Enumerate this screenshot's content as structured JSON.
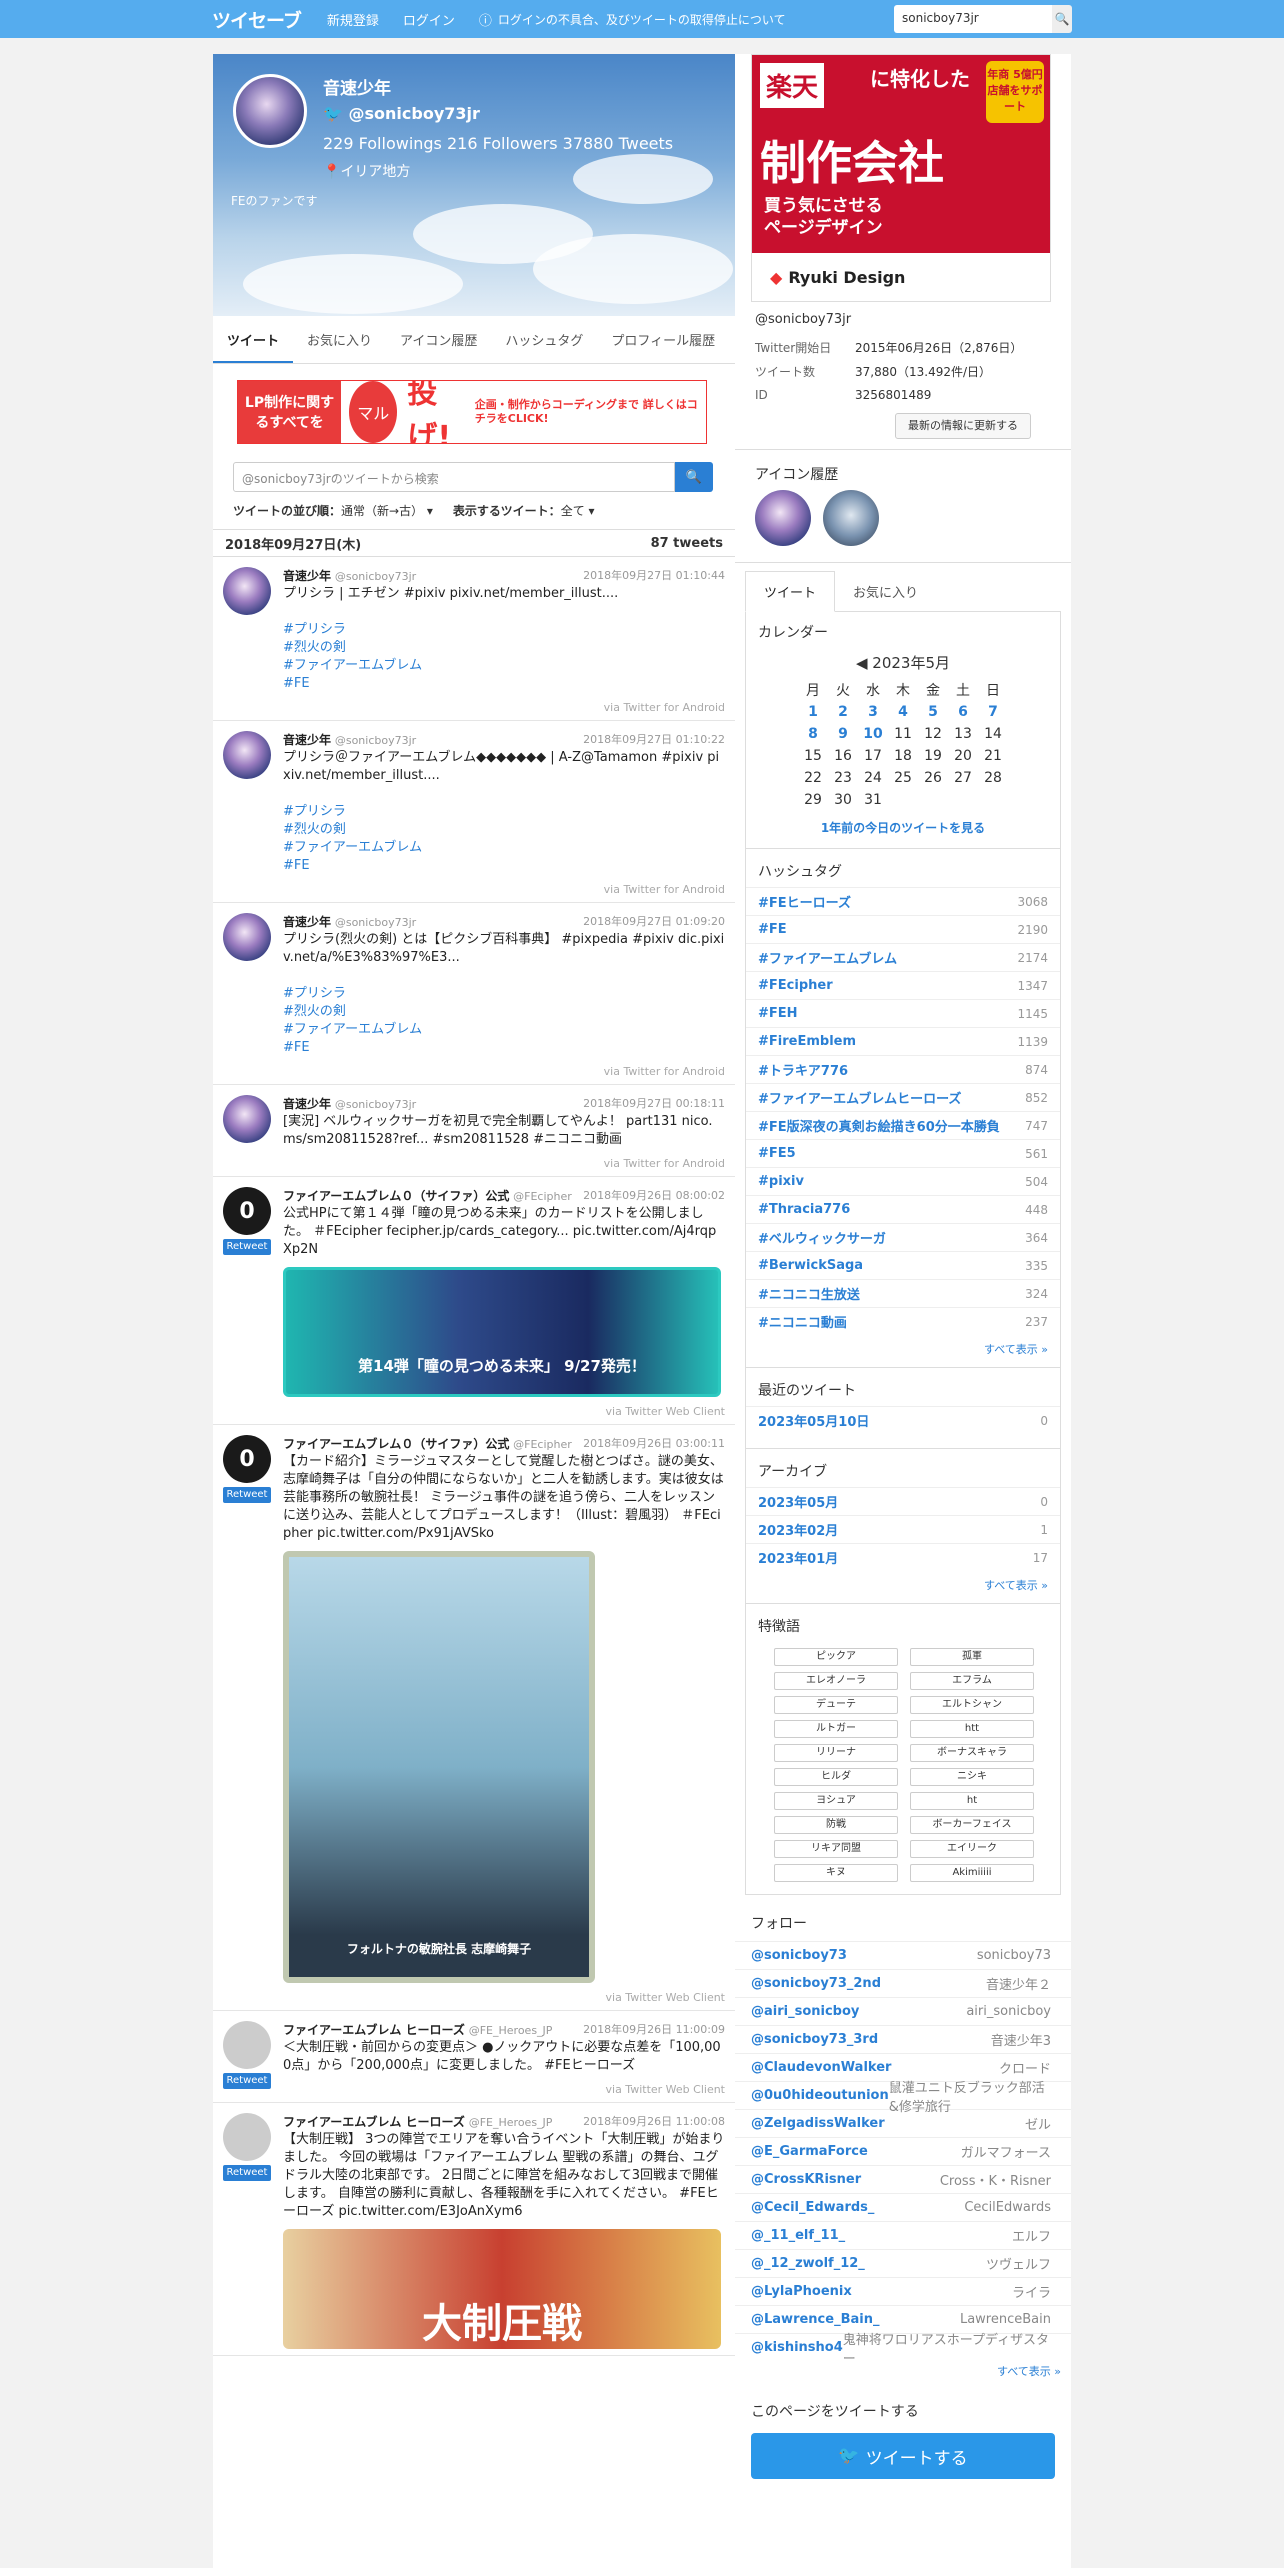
{
  "nav": {
    "logo": "ツイセーブ",
    "register": "新規登録",
    "login": "ログイン",
    "notice": "ログインの不具合、及びツイートの取得停止について",
    "search_value": "sonicboy73jr"
  },
  "profile": {
    "name": "音速少年",
    "handle": "@sonicboy73jr",
    "stats": "229 Followings  216 Followers  37880 Tweets",
    "location": "イリア地方",
    "bio": "FEのファンです"
  },
  "tabs": [
    "ツイート",
    "お気に入り",
    "アイコン履歴",
    "ハッシュタグ",
    "プロフィール履歴"
  ],
  "banner": {
    "t1": "LP制作に関するすべてを",
    "t2": "マル",
    "t3": "投げ!",
    "t4": "企画・制作からコーディングまで 詳しくはコチラをCLICK!"
  },
  "search": {
    "placeholder": "@sonicboy73jrのツイートから検索"
  },
  "sort": {
    "order_label": "ツイートの並び順：",
    "order_value": "通常（新→古）",
    "type_label": "表示するツイート：",
    "type_value": "全て"
  },
  "datebar": {
    "date": "2018年09月27日(木)",
    "count": "87 tweets"
  },
  "tweets": [
    {
      "name": "音速少年",
      "handle": "@sonicboy73jr",
      "time": "2018年09月27日 01:10:44",
      "body": "プリシラ | エチゼン #pixiv pixiv.net/member_illust....",
      "tags": [
        "#プリシラ",
        "#烈火の剣",
        "#ファイアーエムブレム",
        "#FE"
      ],
      "via": "via Twitter for Android"
    },
    {
      "name": "音速少年",
      "handle": "@sonicboy73jr",
      "time": "2018年09月27日 01:10:22",
      "body": "プリシラ＠ファイアーエムブレム◆◆◆◆◆◆◆ | A-Z@Tamamon #pixiv pixiv.net/member_illust....",
      "tags": [
        "#プリシラ",
        "#烈火の剣",
        "#ファイアーエムブレム",
        "#FE"
      ],
      "via": "via Twitter for Android"
    },
    {
      "name": "音速少年",
      "handle": "@sonicboy73jr",
      "time": "2018年09月27日 01:09:20",
      "body": "プリシラ(烈火の剣) とは【ピクシブ百科事典】 #pixpedia #pixiv dic.pixiv.net/a/%E3%83%97%E3...",
      "tags": [
        "#プリシラ",
        "#烈火の剣",
        "#ファイアーエムブレム",
        "#FE"
      ],
      "via": "via Twitter for Android"
    },
    {
      "name": "音速少年",
      "handle": "@sonicboy73jr",
      "time": "2018年09月27日 00:18:11",
      "body": "[実況] ベルウィックサーガを初見で完全制覇してやんよ！ part131 nico.ms/sm20811528?ref... #sm20811528 #ニコニコ動画",
      "tags": [],
      "via": "via Twitter for Android"
    },
    {
      "name": "ファイアーエムブレム０（サイファ）公式",
      "handle": "@FEcipher",
      "time": "2018年09月26日 08:00:02",
      "body": "公式HPにて第１４弾「瞳の見つめる未来」のカードリストを公開しました。 ＃FEcipher fecipher.jp/cards_category... pic.twitter.com/Aj4rqpXp2N",
      "tags": [],
      "via": "via Twitter Web Client",
      "rt": "Retweet",
      "media": "第14弾「瞳の見つめる未来」 9/27発売！"
    },
    {
      "name": "ファイアーエムブレム０（サイファ）公式",
      "handle": "@FEcipher",
      "time": "2018年09月26日 03:00:11",
      "body": "【カード紹介】ミラージュマスターとして覚醒した樹とつばさ。謎の美女、志摩崎舞子は「自分の仲間にならないか」と二人を勧誘します。実は彼女は芸能事務所の敏腕社長！ ミラージュ事件の謎を追う傍ら、二人をレッスンに送り込み、芸能人としてプロデュースします！（Illust：碧風羽） ＃FEcipher pic.twitter.com/Px91jAVSko",
      "tags": [],
      "via": "via Twitter Web Client",
      "rt": "Retweet",
      "media": "フォルトナの敏腕社長 志摩崎舞子"
    },
    {
      "name": "ファイアーエムブレム ヒーローズ",
      "handle": "@FE_Heroes_JP",
      "time": "2018年09月26日 11:00:09",
      "body": "＜大制圧戦・前回からの変更点＞ ●ノックアウトに必要な点差を「100,000点」から「200,000点」に変更しました。 #FEヒーローズ",
      "tags": [],
      "via": "via Twitter Web Client",
      "rt": "Retweet"
    },
    {
      "name": "ファイアーエムブレム ヒーローズ",
      "handle": "@FE_Heroes_JP",
      "time": "2018年09月26日 11:00:08",
      "body": "【大制圧戦】 3つの陣営でエリアを奪い合うイベント「大制圧戦」が始まりました。 今回の戦場は「ファイアーエムブレム 聖戦の系譜」の舞台、ユグドラル大陸の北東部です。 2日間ごとに陣営を組みなおして3回戦まで開催します。 自陣営の勝利に貢献し、各種報酬を手に入れてください。 #FEヒーローズ pic.twitter.com/E3JoAnXym6",
      "tags": [],
      "via": "",
      "rt": "Retweet",
      "media": "大制圧戦"
    }
  ],
  "ad": {
    "raku": "楽天",
    "t1": "に特化した",
    "badge": "年商 5億円 店舗をサポート",
    "t2": "制作会社",
    "t3": "買う気にさせる ページデザイン",
    "bottom": "Ryuki Design"
  },
  "info": {
    "handle": "@sonicboy73jr",
    "rows": [
      {
        "k": "Twitter開始日",
        "v": "2015年06月26日（2,876日）"
      },
      {
        "k": "ツイート数",
        "v": "37,880（13.492件/日）"
      },
      {
        "k": "ID",
        "v": "3256801489"
      }
    ],
    "update": "最新の情報に更新する"
  },
  "icon_history_title": "アイコン履歴",
  "stabs": [
    "ツイート",
    "お気に入り"
  ],
  "calendar": {
    "title": "カレンダー",
    "month": "◀ 2023年5月",
    "week": [
      "月",
      "火",
      "水",
      "木",
      "金",
      "土",
      "日"
    ],
    "rows": [
      [
        "1",
        "2",
        "3",
        "4",
        "5",
        "6",
        "7"
      ],
      [
        "8",
        "9",
        "10",
        "11",
        "12",
        "13",
        "14"
      ],
      [
        "15",
        "16",
        "17",
        "18",
        "19",
        "20",
        "21"
      ],
      [
        "22",
        "23",
        "24",
        "25",
        "26",
        "27",
        "28"
      ],
      [
        "29",
        "30",
        "31",
        "",
        "",
        "",
        ""
      ]
    ],
    "link": "1年前の今日のツイートを見る"
  },
  "hashtags": {
    "title": "ハッシュタグ",
    "items": [
      [
        "#FEヒーローズ",
        "3068"
      ],
      [
        "#FE",
        "2190"
      ],
      [
        "#ファイアーエムブレム",
        "2174"
      ],
      [
        "#FEcipher",
        "1347"
      ],
      [
        "#FEH",
        "1145"
      ],
      [
        "#FireEmblem",
        "1139"
      ],
      [
        "#トラキア776",
        "874"
      ],
      [
        "#ファイアーエムブレムヒーローズ",
        "852"
      ],
      [
        "#FE版深夜の真剣お絵描き60分一本勝負",
        "747"
      ],
      [
        "#FE5",
        "561"
      ],
      [
        "#pixiv",
        "504"
      ],
      [
        "#Thracia776",
        "448"
      ],
      [
        "#ベルウィックサーガ",
        "364"
      ],
      [
        "#BerwickSaga",
        "335"
      ],
      [
        "#ニコニコ生放送",
        "324"
      ],
      [
        "#ニコニコ動画",
        "237"
      ]
    ],
    "more": "すべて表示 »"
  },
  "recent": {
    "title": "最近のツイート",
    "items": [
      [
        "2023年05月10日",
        "0"
      ]
    ]
  },
  "archive": {
    "title": "アーカイブ",
    "items": [
      [
        "2023年05月",
        "0"
      ],
      [
        "2023年02月",
        "1"
      ],
      [
        "2023年01月",
        "17"
      ]
    ],
    "more": "すべて表示 »"
  },
  "features": {
    "title": "特徴語",
    "items": [
      "ピックア",
      "孤軍",
      "エレオノーラ",
      "エフラム",
      "デューテ",
      "エルトシャン",
      "ルトガー",
      "htt",
      "リリーナ",
      "ボーナスキャラ",
      "ヒルダ",
      "ニシキ",
      "ヨシュア",
      "ht",
      "防戦",
      "ボーカーフェイス",
      "リキア同盟",
      "エイリーク",
      "キヌ",
      "Akimiiiii"
    ]
  },
  "follow": {
    "title": "フォロー",
    "items": [
      [
        "@sonicboy73",
        "sonicboy73"
      ],
      [
        "@sonicboy73_2nd",
        "音速少年２"
      ],
      [
        "@airi_sonicboy",
        "airi_sonicboy"
      ],
      [
        "@sonicboy73_3rd",
        "音速少年3"
      ],
      [
        "@ClaudevonWalker",
        "クロード"
      ],
      [
        "@0u0hideoutunion",
        "鼠灌ユニト反ブラック部活&修学旅行"
      ],
      [
        "@ZelgadissWalker",
        "ゼル"
      ],
      [
        "@E_GarmaForce",
        "ガルマフォース"
      ],
      [
        "@CrossKRisner",
        "Cross・K・Risner"
      ],
      [
        "@Cecil_Edwards_",
        "CecilEdwards"
      ],
      [
        "@_11_elf_11_",
        "エルフ"
      ],
      [
        "@_12_zwolf_12_",
        "ツヴェルフ"
      ],
      [
        "@LylaPhoenix",
        "ライラ"
      ],
      [
        "@Lawrence_Bain_",
        "LawrenceBain"
      ],
      [
        "@kishinsho4",
        "鬼神将ワロリアスホープディザスター"
      ]
    ],
    "more": "すべて表示 »"
  },
  "share": {
    "title": "このページをツイートする",
    "button": "ツイートする"
  }
}
